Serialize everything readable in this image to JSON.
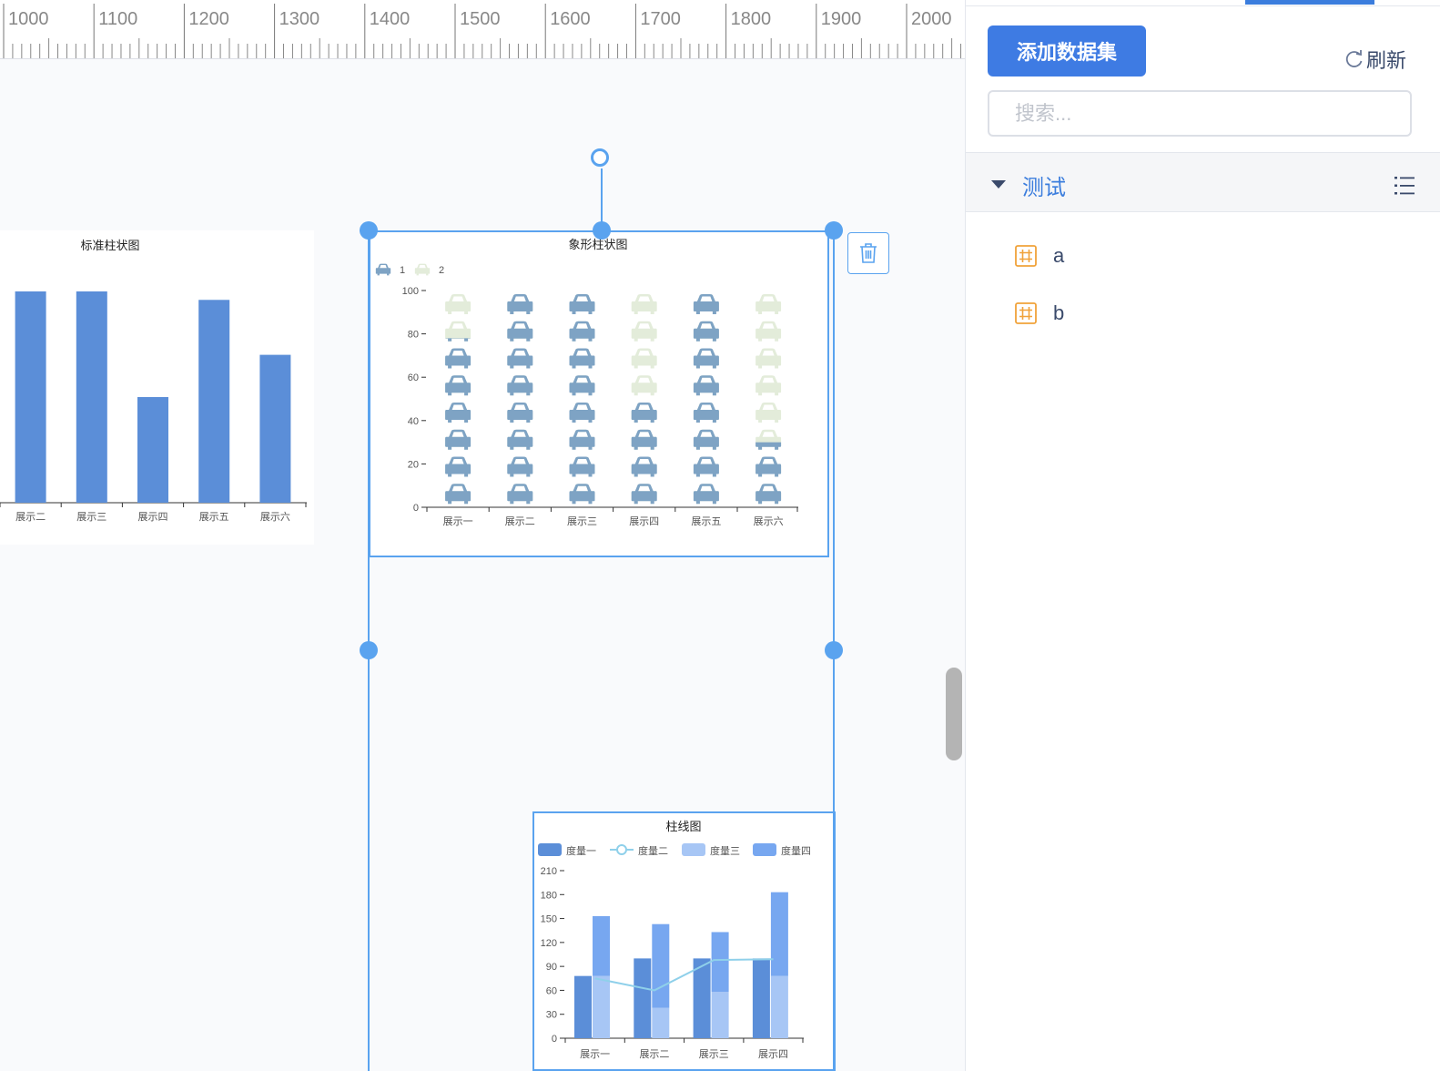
{
  "ruler": {
    "labels": [
      "1000",
      "1100",
      "1200",
      "1300",
      "1400",
      "1500",
      "1600",
      "1700",
      "1800",
      "1900",
      "2000"
    ]
  },
  "charts": {
    "standard_bar_title": "标准柱状图",
    "pictorial_title": "象形柱状图",
    "combo_title": "柱线图"
  },
  "right_panel": {
    "add_dataset_label": "添加数据集",
    "refresh_label": "刷新",
    "search_placeholder": "搜索...",
    "group_label": "测试",
    "datasets": [
      "a",
      "b"
    ]
  },
  "colors": {
    "accent": "#3e7be3",
    "selection": "#5aa3ef",
    "bar": "#5b8ed8",
    "car_dark": "#7ea3c4",
    "car_light": "#e3ecda",
    "line": "#8fd0ea",
    "bar_light": "#a7c6f5",
    "bar_mid": "#77a7f0"
  },
  "chart_data": [
    {
      "type": "bar",
      "title": "标准柱状图",
      "categories": [
        "展示二",
        "展示三",
        "展示四",
        "展示五",
        "展示六"
      ],
      "values": [
        100,
        100,
        50,
        96,
        70
      ],
      "ylim": [
        0,
        100
      ]
    },
    {
      "type": "bar",
      "title": "象形柱状图",
      "categories": [
        "展示一",
        "展示二",
        "展示三",
        "展示四",
        "展示五",
        "展示六"
      ],
      "legend": [
        "1",
        "2"
      ],
      "series": [
        {
          "name": "1",
          "values": [
            78,
            100,
            100,
            50,
            100,
            30
          ]
        },
        {
          "name": "2",
          "values": [
            100,
            100,
            100,
            100,
            100,
            100
          ]
        }
      ],
      "yticks": [
        "0",
        "20",
        "40",
        "60",
        "80",
        "100"
      ],
      "ylim": [
        0,
        100
      ]
    },
    {
      "type": "bar",
      "title": "柱线图",
      "categories": [
        "展示一",
        "展示二",
        "展示三",
        "展示四"
      ],
      "legend": [
        "度量一",
        "度量二",
        "度量三",
        "度量四"
      ],
      "series": [
        {
          "name": "度量一",
          "kind": "bar",
          "values": [
            78,
            100,
            100,
            100
          ]
        },
        {
          "name": "度量二",
          "kind": "line",
          "values": [
            75,
            60,
            98,
            99
          ]
        },
        {
          "name": "度量三",
          "kind": "bar-stack",
          "values": [
            78,
            38,
            58,
            78
          ]
        },
        {
          "name": "度量四",
          "kind": "bar-stack",
          "values": [
            75,
            105,
            75,
            105
          ]
        }
      ],
      "yticks": [
        "0",
        "30",
        "60",
        "90",
        "120",
        "150",
        "180",
        "210"
      ],
      "ylim": [
        0,
        210
      ]
    }
  ]
}
